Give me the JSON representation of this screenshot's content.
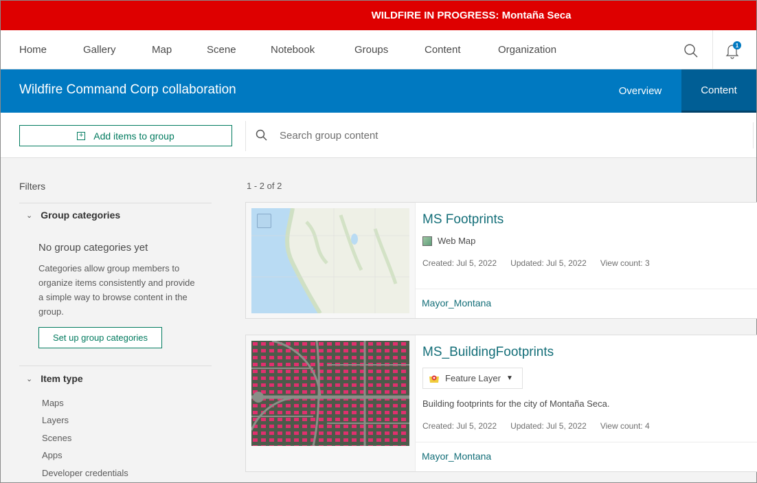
{
  "banner": {
    "text": "WILDFIRE IN PROGRESS: Montaña Seca",
    "color": "#de0000"
  },
  "topnav": {
    "items": [
      "Home",
      "Gallery",
      "Map",
      "Scene",
      "Notebook",
      "Groups",
      "Content",
      "Organization"
    ],
    "search_icon": "search-icon",
    "notifications_icon": "bell-icon",
    "notification_count": "1"
  },
  "group": {
    "title": "Wildfire Command Corp collaboration",
    "tabs": [
      {
        "label": "Overview",
        "active": false
      },
      {
        "label": "Content",
        "active": true
      }
    ],
    "brand_color": "#0079c1"
  },
  "toolbar": {
    "add_label": "Add items to group",
    "search_placeholder": "Search group content",
    "search_value": ""
  },
  "sidebar": {
    "title": "Filters",
    "group_categories": {
      "label": "Group categories",
      "empty_title": "No group categories yet",
      "empty_desc": "Categories allow group members to organize items consistently and provide a simple way to browse content in the group.",
      "setup_label": "Set up group categories"
    },
    "item_type": {
      "label": "Item type",
      "options": [
        "Maps",
        "Layers",
        "Scenes",
        "Apps",
        "Developer credentials"
      ]
    }
  },
  "results": {
    "count_text": "1 - 2 of 2",
    "items": [
      {
        "title": "MS Footprints",
        "type": "Web Map",
        "description": "",
        "created": "Created: Jul 5, 2022",
        "updated": "Updated: Jul 5, 2022",
        "views": "View count: 3",
        "owner": "Mayor_Montana"
      },
      {
        "title": "MS_BuildingFootprints",
        "type": "Feature Layer",
        "description": "Building footprints for the city of Montaña Seca.",
        "created": "Created: Jul 5, 2022",
        "updated": "Updated: Jul 5, 2022",
        "views": "View count: 4",
        "owner": "Mayor_Montana"
      }
    ]
  },
  "colors": {
    "accent_green": "#007a5e",
    "link_teal": "#136e78"
  }
}
